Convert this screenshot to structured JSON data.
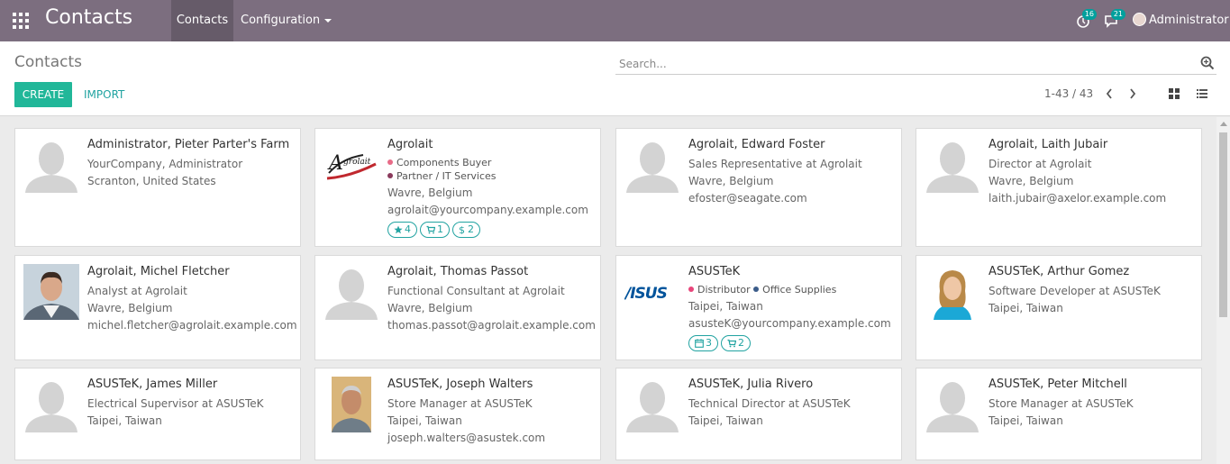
{
  "topbar": {
    "brand": "Contacts",
    "menu_contacts": "Contacts",
    "menu_configuration": "Configuration",
    "activity_count": "16",
    "messages_count": "21",
    "user_name": "Administrator"
  },
  "control": {
    "title": "Contacts",
    "search_placeholder": "Search...",
    "create_label": "CREATE",
    "import_label": "IMPORT",
    "pager": "1-43 / 43"
  },
  "colors": {
    "nav": "#7c6e7f",
    "accent": "#21b799",
    "link": "#21a3a1"
  },
  "cards": [
    {
      "name": "Administrator, Pieter Parter's Farm",
      "avatar": "default-avatar-icon",
      "lines": [
        "YourCompany, Administrator",
        "Scranton, United States"
      ]
    },
    {
      "name": "Agrolait",
      "avatar": "agrolait-logo",
      "tags": [
        {
          "label": "Components Buyer",
          "color": "#e86b87"
        },
        {
          "label": "Partner / IT Services",
          "color": "#8a3a5c"
        }
      ],
      "lines": [
        "Wavre, Belgium",
        "agrolait@yourcompany.example.com"
      ],
      "pills": [
        {
          "icon": "star-icon",
          "value": "4"
        },
        {
          "icon": "cart-icon",
          "value": "1"
        },
        {
          "icon": "dollar-icon",
          "value": "2"
        }
      ]
    },
    {
      "name": "Agrolait, Edward Foster",
      "avatar": "default-avatar-icon",
      "lines": [
        "Sales Representative at Agrolait",
        "Wavre, Belgium",
        "efoster@seagate.com"
      ]
    },
    {
      "name": "Agrolait, Laith Jubair",
      "avatar": "default-avatar-icon",
      "lines": [
        "Director at Agrolait",
        "Wavre, Belgium",
        "laith.jubair@axelor.example.com"
      ]
    },
    {
      "name": "Agrolait, Michel Fletcher",
      "avatar": "photo-man",
      "lines": [
        "Analyst at Agrolait",
        "Wavre, Belgium",
        "michel.fletcher@agrolait.example.com"
      ]
    },
    {
      "name": "Agrolait, Thomas Passot",
      "avatar": "default-avatar-icon",
      "lines": [
        "Functional Consultant at Agrolait",
        "Wavre, Belgium",
        "thomas.passot@agrolait.example.com"
      ]
    },
    {
      "name": "ASUSTeK",
      "avatar": "asus-logo",
      "tags": [
        {
          "label": "Distributor",
          "color": "#e8457a"
        },
        {
          "label": "Office Supplies",
          "color": "#3b5c8a"
        }
      ],
      "lines": [
        "Taipei, Taiwan",
        "asusteK@yourcompany.example.com"
      ],
      "pills": [
        {
          "icon": "calendar-icon",
          "value": "3"
        },
        {
          "icon": "cart-icon",
          "value": "2"
        }
      ]
    },
    {
      "name": "ASUSTeK, Arthur Gomez",
      "avatar": "photo-woman",
      "lines": [
        "Software Developer at ASUSTeK",
        "Taipei, Taiwan"
      ]
    },
    {
      "name": "ASUSTeK, James Miller",
      "avatar": "default-avatar-icon",
      "lines": [
        "Electrical Supervisor at ASUSTeK",
        "Taipei, Taiwan"
      ]
    },
    {
      "name": "ASUSTeK, Joseph Walters",
      "avatar": "photo-older-man",
      "lines": [
        "Store Manager at ASUSTeK",
        "Taipei, Taiwan",
        "joseph.walters@asustek.com"
      ]
    },
    {
      "name": "ASUSTeK, Julia Rivero",
      "avatar": "default-avatar-icon",
      "lines": [
        "Technical Director at ASUSTeK",
        "Taipei, Taiwan"
      ]
    },
    {
      "name": "ASUSTeK, Peter Mitchell",
      "avatar": "default-avatar-icon",
      "lines": [
        "Store Manager at ASUSTeK",
        "Taipei, Taiwan"
      ]
    }
  ]
}
